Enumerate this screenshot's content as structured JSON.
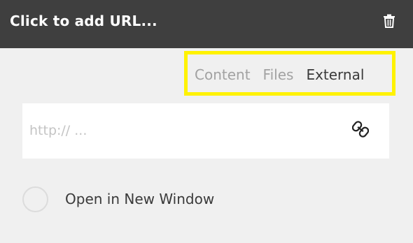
{
  "header": {
    "title": "Click to add URL...",
    "delete_icon": "trash-icon"
  },
  "tabs": [
    {
      "label": "Content",
      "active": false
    },
    {
      "label": "Files",
      "active": false
    },
    {
      "label": "External",
      "active": true
    }
  ],
  "url_field": {
    "placeholder": "http:// ...",
    "value": "",
    "icon": "link-icon"
  },
  "open_new_window": {
    "label": "Open in New Window",
    "checked": false
  },
  "colors": {
    "header_bg": "#3f3f3f",
    "highlight": "#fff200",
    "panel_bg": "#f0f0f0"
  }
}
